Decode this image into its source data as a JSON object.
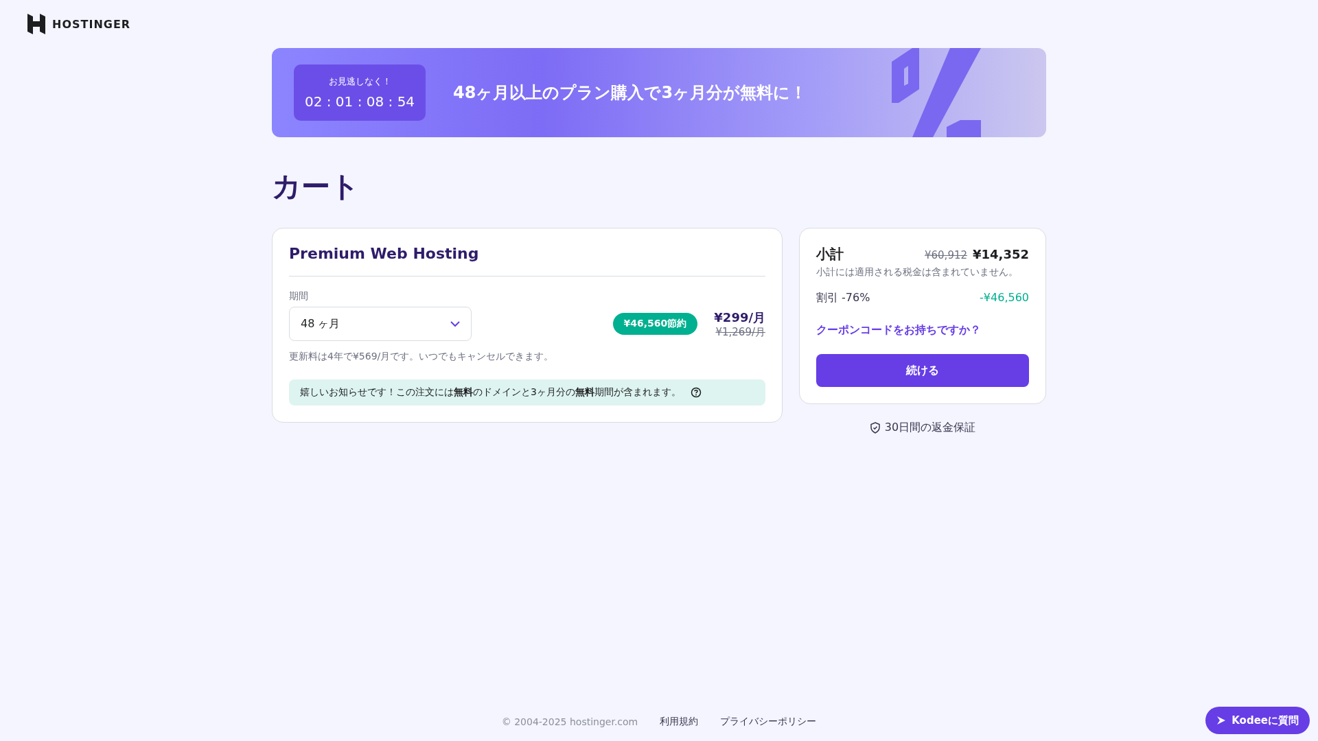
{
  "brand": {
    "name": "HOSTINGER"
  },
  "promo": {
    "eyebrow": "お見逃しなく！",
    "countdown": "02 : 01 : 08 : 54",
    "headline": "48ヶ月以上のプラン購入で3ヶ月分が無料に！"
  },
  "page_title": "カート",
  "cart_item": {
    "product": "Premium Web Hosting",
    "period_label": "期間",
    "period_value": "48 ヶ月",
    "savings_badge": "¥46,560節約",
    "price": "¥299/月",
    "original_price": "¥1,269/月",
    "renewal_note": "更新料は4年で¥569/月です。いつでもキャンセルできます。",
    "notice": "嬉しいお知らせです！この注文には**無料**のドメインと3ヶ月分の**無料**期間が含まれます。"
  },
  "summary": {
    "title": "小計",
    "original_total": "¥60,912",
    "total": "¥14,352",
    "tax_note": "小計には適用される税金は含まれていません。",
    "discount_label": "割引 -76%",
    "discount_value": "-¥46,560",
    "coupon_link": "クーポンコードをお持ちですか？",
    "continue_button": "続ける"
  },
  "guarantee": "30日間の返金保証",
  "footer": {
    "copyright": "© 2004-2025 hostinger.com",
    "links": [
      "利用規約",
      "プライバシーポリシー"
    ]
  },
  "chat_button": "Kodeeに質問"
}
